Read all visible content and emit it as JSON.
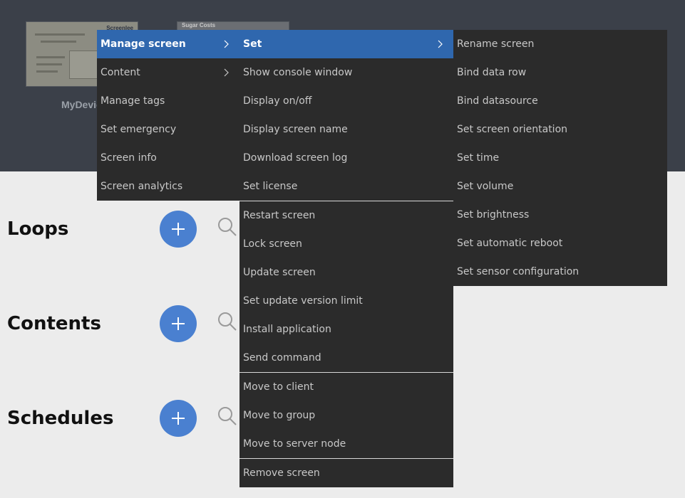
{
  "device": {
    "label": "MyDevic",
    "thumb2_title": "Sugar Costs",
    "thumb1_logo": "Screenlee"
  },
  "sections": [
    {
      "title": "Loops"
    },
    {
      "title": "Contents"
    },
    {
      "title": "Schedules"
    }
  ],
  "menu1": {
    "items": [
      {
        "label": "Manage screen"
      },
      {
        "label": "Content"
      },
      {
        "label": "Manage tags"
      },
      {
        "label": "Set emergency"
      },
      {
        "label": "Screen info"
      },
      {
        "label": "Screen analytics"
      }
    ]
  },
  "menu2": {
    "items": [
      {
        "label": "Set"
      },
      {
        "label": "Show console window"
      },
      {
        "label": "Display on/off"
      },
      {
        "label": "Display screen name"
      },
      {
        "label": "Download screen log"
      },
      {
        "label": "Set license"
      },
      {
        "label": "Restart screen"
      },
      {
        "label": "Lock screen"
      },
      {
        "label": "Update screen"
      },
      {
        "label": "Set update version limit"
      },
      {
        "label": "Install application"
      },
      {
        "label": "Send command"
      },
      {
        "label": "Move to client"
      },
      {
        "label": "Move to group"
      },
      {
        "label": "Move to server node"
      },
      {
        "label": "Remove screen"
      }
    ]
  },
  "menu3": {
    "items": [
      {
        "label": "Rename screen"
      },
      {
        "label": "Bind data row"
      },
      {
        "label": "Bind datasource"
      },
      {
        "label": "Set screen orientation"
      },
      {
        "label": "Set time"
      },
      {
        "label": "Set volume"
      },
      {
        "label": "Set brightness"
      },
      {
        "label": "Set automatic reboot"
      },
      {
        "label": "Set sensor configuration"
      }
    ]
  },
  "colors": {
    "accent": "#2f67ae",
    "add_button": "#4a80d0",
    "menu_bg": "#2b2b2b",
    "header_bg": "#3b4049"
  }
}
